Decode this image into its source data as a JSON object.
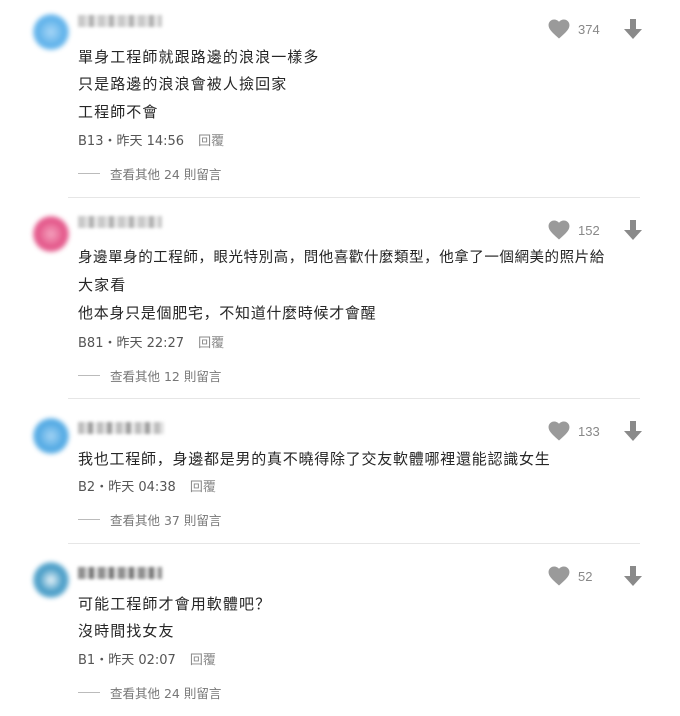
{
  "comments": [
    {
      "likes": "374",
      "lines": [
        "單身工程師就跟路邊的浪浪一樣多",
        "只是路邊的浪浪會被人撿回家",
        "工程師不會"
      ],
      "floor": "B13",
      "time": "昨天 14:56",
      "reply_label": "回覆",
      "more_label": "查看其他 24 則留言",
      "avatar_color": "#4aa8e8"
    },
    {
      "likes": "152",
      "lines": [
        "身邊單身的工程師，眼光特別高，問他喜歡什麼類型，他拿了一個網美的照片給",
        "大家看",
        "他本身只是個肥宅，不知道什麼時候才會醒"
      ],
      "floor": "B81",
      "time": "昨天 22:27",
      "reply_label": "回覆",
      "more_label": "查看其他 12 則留言",
      "avatar_color": "#e0407a"
    },
    {
      "likes": "133",
      "lines": [
        "我也工程師，身邊都是男的真不曉得除了交友軟體哪裡還能認識女生"
      ],
      "floor": "B2",
      "time": "昨天 04:38",
      "reply_label": "回覆",
      "more_label": "查看其他 37 則留言",
      "avatar_color": "#3b9ee0"
    },
    {
      "likes": "52",
      "lines": [
        "可能工程師才會用軟體吧？",
        "沒時間找女友"
      ],
      "floor": "B1",
      "time": "昨天 02:07",
      "reply_label": "回覆",
      "more_label": "查看其他 24 則留言",
      "avatar_color": "#2f8fbf"
    }
  ],
  "separator": "・",
  "icons": {
    "like": "heart-icon",
    "dislike": "down-arrow-icon"
  },
  "colors": {
    "icon_gray": "#9a9a9a",
    "text": "#262626",
    "muted": "#888888"
  }
}
